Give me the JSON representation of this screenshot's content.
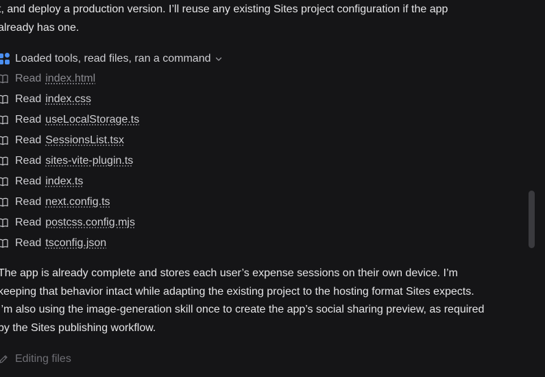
{
  "intro": {
    "line1": "t, and deploy a production version. I’ll reuse any existing Sites project configuration if the app",
    "line2": "already has one."
  },
  "activity": {
    "icon": "tools-grid-icon",
    "label": "Loaded tools, read files, ran a command",
    "toggle_icon": "chevron-down-icon",
    "accent_color": "#4b8ff0"
  },
  "reads": [
    {
      "verb": "Read",
      "file": "index.html"
    },
    {
      "verb": "Read",
      "file": "index.css"
    },
    {
      "verb": "Read",
      "file": "useLocalStorage.ts"
    },
    {
      "verb": "Read",
      "file": "SessionsList.tsx"
    },
    {
      "verb": "Read",
      "file": "sites-vite-plugin.ts"
    },
    {
      "verb": "Read",
      "file": "index.ts"
    },
    {
      "verb": "Read",
      "file": "next.config.ts"
    },
    {
      "verb": "Read",
      "file": "postcss.config.mjs"
    },
    {
      "verb": "Read",
      "file": "tsconfig.json"
    }
  ],
  "message": {
    "line1": "The app is already complete and stores each user’s expense sessions on their own device. I’m",
    "line2": "keeping that behavior intact while adapting the existing project to the hosting format Sites expects.",
    "line3": "I’m also using the image-generation skill once to create the app’s social sharing preview, as required",
    "line4": "by the Sites publishing workflow."
  },
  "status": {
    "icon": "pencil-icon",
    "label": "Editing files"
  }
}
